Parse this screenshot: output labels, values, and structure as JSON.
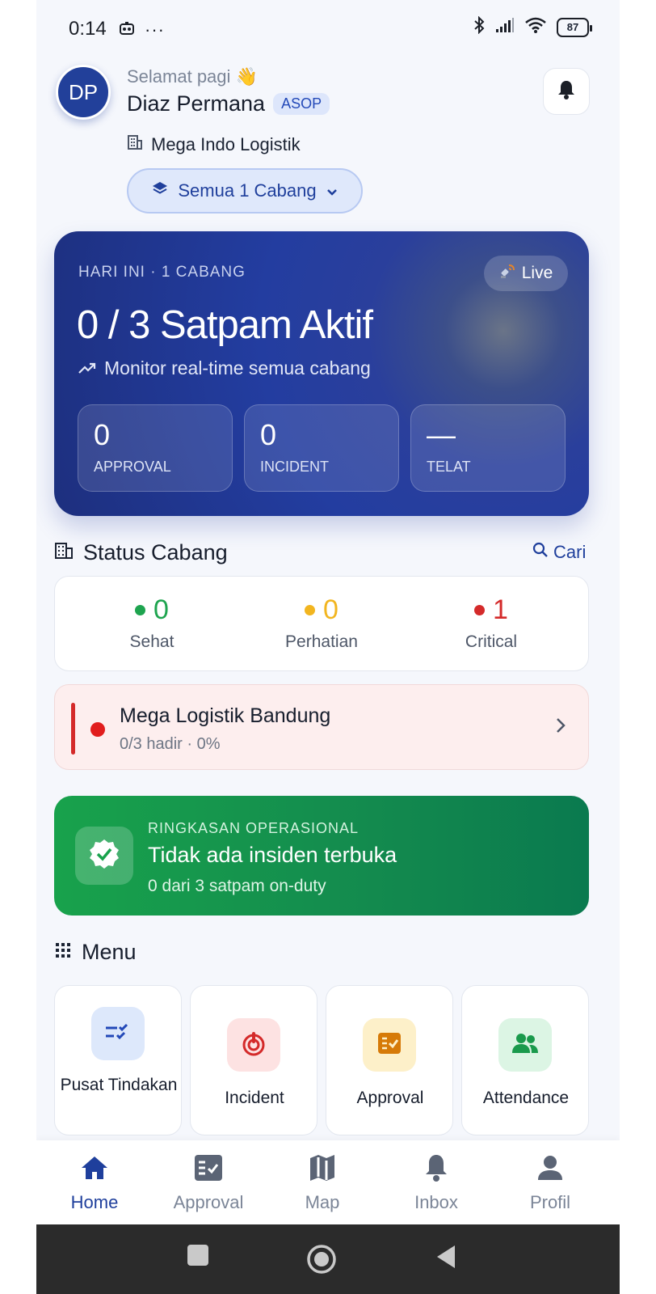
{
  "status_bar": {
    "time": "0:14",
    "dots": "···",
    "battery": "87"
  },
  "header": {
    "avatar_initials": "DP",
    "greeting": "Selamat pagi 👋",
    "user_name": "Diaz Permana",
    "role": "ASOP",
    "company": "Mega Indo Logistik",
    "branch_selector": "Semua 1 Cabang"
  },
  "hero": {
    "label": "HARI INI · 1 CABANG",
    "live": "Live",
    "title": "0 / 3 Satpam Aktif",
    "subtitle": "Monitor real-time semua cabang",
    "stats": [
      {
        "value": "0",
        "label": "APPROVAL"
      },
      {
        "value": "0",
        "label": "INCIDENT"
      },
      {
        "value": "—",
        "label": "TELAT"
      }
    ]
  },
  "status_cabang": {
    "title": "Status Cabang",
    "search_label": "Cari",
    "summary": [
      {
        "count": "0",
        "label": "Sehat",
        "color": "#1ea44f"
      },
      {
        "count": "0",
        "label": "Perhatian",
        "color": "#f2b51f"
      },
      {
        "count": "1",
        "label": "Critical",
        "color": "#d42a2a"
      }
    ],
    "branches": [
      {
        "name": "Mega Logistik Bandung",
        "meta": "0/3 hadir · 0%",
        "status_color": "#e11d1d"
      }
    ]
  },
  "ops_summary": {
    "label": "RINGKASAN OPERASIONAL",
    "title": "Tidak ada insiden terbuka",
    "subtitle": "0 dari 3 satpam on-duty"
  },
  "menu": {
    "title": "Menu",
    "items": [
      {
        "label": "Pusat Tindakan",
        "icon": "checklist-icon",
        "bg": "#dde8fb",
        "color": "#2349b8"
      },
      {
        "label": "Incident",
        "icon": "alarm-icon",
        "bg": "#fde2e2",
        "color": "#d42a2a"
      },
      {
        "label": "Approval",
        "icon": "approval-icon",
        "bg": "#fdf0c9",
        "color": "#d67a08"
      },
      {
        "label": "Attendance",
        "icon": "people-icon",
        "bg": "#dcf5e4",
        "color": "#1a9a4c"
      }
    ]
  },
  "bottom_nav": {
    "items": [
      {
        "label": "Home",
        "icon": "home-icon",
        "active": true
      },
      {
        "label": "Approval",
        "icon": "approval-list-icon",
        "active": false
      },
      {
        "label": "Map",
        "icon": "map-icon",
        "active": false
      },
      {
        "label": "Inbox",
        "icon": "bell-icon",
        "active": false
      },
      {
        "label": "Profil",
        "icon": "person-icon",
        "active": false
      }
    ]
  },
  "colors": {
    "primary": "#1f3f9c",
    "hero_bg": "#233da0",
    "success": "#18a24c",
    "critical": "#d42a2a"
  }
}
